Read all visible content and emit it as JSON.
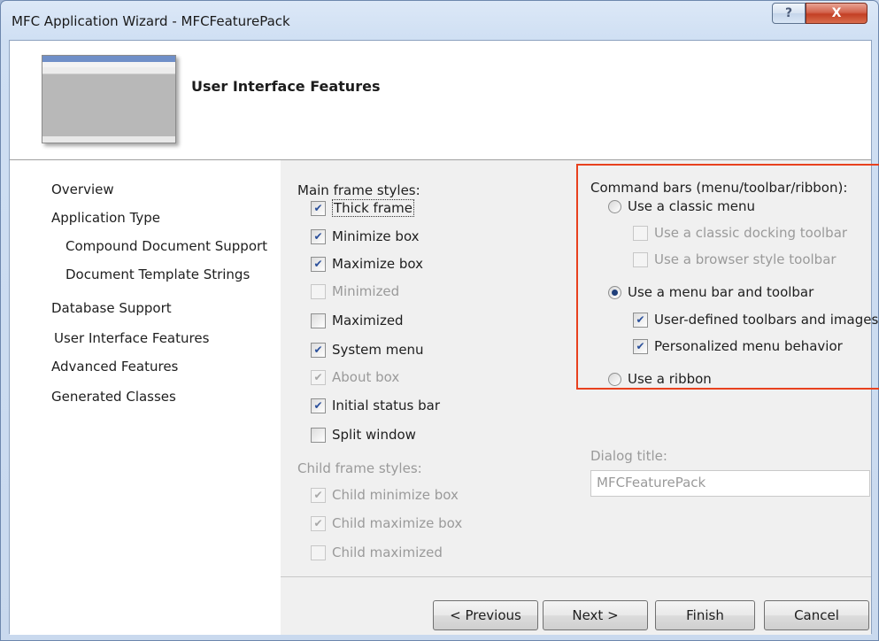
{
  "window": {
    "title": "MFC Application Wizard - MFCFeaturePack",
    "help_glyph": "?",
    "close_glyph": "X"
  },
  "header": {
    "heading": "User Interface Features",
    "preview_icon": "app-preview-thumbnail"
  },
  "nav": {
    "items": [
      {
        "label": "Overview"
      },
      {
        "label": "Application Type"
      },
      {
        "label": "Compound Document Support"
      },
      {
        "label": "Document Template Strings"
      },
      {
        "label": "Database Support"
      },
      {
        "label": "User Interface Features",
        "selected": true
      },
      {
        "label": "Advanced Features"
      },
      {
        "label": "Generated Classes"
      }
    ]
  },
  "main_frame": {
    "label": "Main frame styles:",
    "options": [
      {
        "label": "Thick frame",
        "checked": true,
        "enabled": true
      },
      {
        "label": "Minimize box",
        "checked": true,
        "enabled": true
      },
      {
        "label": "Maximize box",
        "checked": true,
        "enabled": true
      },
      {
        "label": "Minimized",
        "checked": false,
        "enabled": false
      },
      {
        "label": "Maximized",
        "checked": false,
        "enabled": true
      },
      {
        "label": "System menu",
        "checked": true,
        "enabled": true
      },
      {
        "label": "About box",
        "checked": true,
        "enabled": false
      },
      {
        "label": "Initial status bar",
        "checked": true,
        "enabled": true
      },
      {
        "label": "Split window",
        "checked": false,
        "enabled": true
      }
    ]
  },
  "child_frame": {
    "label": "Child frame styles:",
    "options": [
      {
        "label": "Child minimize box",
        "checked": true,
        "enabled": false
      },
      {
        "label": "Child maximize box",
        "checked": true,
        "enabled": false
      },
      {
        "label": "Child maximized",
        "checked": false,
        "enabled": false
      }
    ]
  },
  "command_bars": {
    "label": "Command bars (menu/toolbar/ribbon):",
    "classic_menu": {
      "label": "Use a classic menu",
      "selected": false
    },
    "classic_docking": {
      "label": "Use a classic docking toolbar",
      "checked": false,
      "enabled": false
    },
    "browser_toolbar": {
      "label": "Use a browser style toolbar",
      "checked": false,
      "enabled": false
    },
    "menu_bar": {
      "label": "Use a menu bar and toolbar",
      "selected": true
    },
    "user_defined": {
      "label": "User-defined toolbars and images",
      "checked": true,
      "enabled": true
    },
    "personalized": {
      "label": "Personalized menu behavior",
      "checked": true,
      "enabled": true
    },
    "ribbon": {
      "label": "Use a ribbon",
      "selected": false
    },
    "highlight_color": "#e8411e"
  },
  "dialog_title": {
    "label": "Dialog title:",
    "value": "MFCFeaturePack"
  },
  "buttons": {
    "previous": "< Previous",
    "next": "Next >",
    "finish": "Finish",
    "cancel": "Cancel"
  },
  "colors": {
    "close_button": "#c33f24",
    "checkmark": "#2a4f9a",
    "disabled_text": "#9a9a9a"
  }
}
